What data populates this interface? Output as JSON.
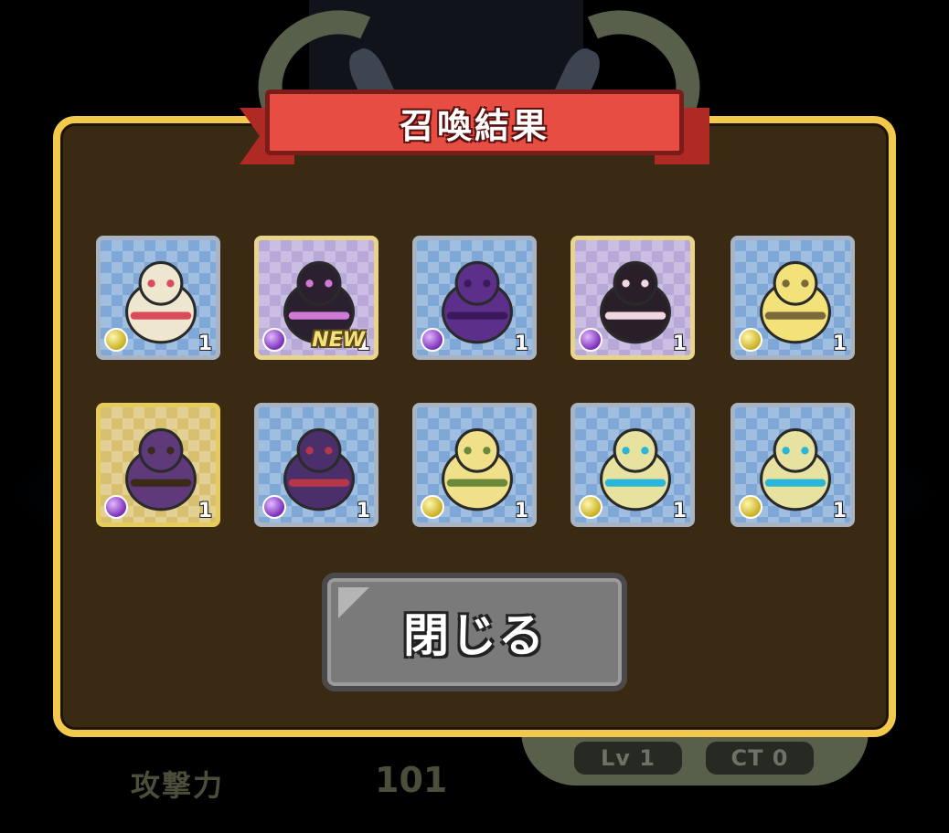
{
  "dialog": {
    "title": "召喚結果",
    "close_label": "閉じる"
  },
  "results": [
    {
      "element": "gold",
      "rarity": "normal",
      "count": "1",
      "new_badge": "",
      "body_color": "#efe6cf",
      "accent_color": "#d94b5a"
    },
    {
      "element": "purple",
      "rarity": "rainbow",
      "count": "1",
      "new_badge": "NEW",
      "body_color": "#2b2030",
      "accent_color": "#d07ad8"
    },
    {
      "element": "purple",
      "rarity": "normal",
      "count": "1",
      "new_badge": "",
      "body_color": "#5c2f8a",
      "accent_color": "#3a1a5a"
    },
    {
      "element": "purple",
      "rarity": "rainbow",
      "count": "1",
      "new_badge": "",
      "body_color": "#2a1e28",
      "accent_color": "#f0d8e0"
    },
    {
      "element": "gold",
      "rarity": "normal",
      "count": "1",
      "new_badge": "",
      "body_color": "#f3e27a",
      "accent_color": "#7a6a3a"
    },
    {
      "element": "purple",
      "rarity": "gold",
      "count": "1",
      "new_badge": "",
      "body_color": "#5e3a7a",
      "accent_color": "#3a2a1a"
    },
    {
      "element": "purple",
      "rarity": "normal",
      "count": "1",
      "new_badge": "",
      "body_color": "#4a2f6a",
      "accent_color": "#b8364a"
    },
    {
      "element": "gold",
      "rarity": "normal",
      "count": "1",
      "new_badge": "",
      "body_color": "#f0e08a",
      "accent_color": "#6a8a3a"
    },
    {
      "element": "gold",
      "rarity": "normal",
      "count": "1",
      "new_badge": "",
      "body_color": "#e8e2a0",
      "accent_color": "#2ab6d8"
    },
    {
      "element": "gold",
      "rarity": "normal",
      "count": "1",
      "new_badge": "",
      "body_color": "#e8e2a0",
      "accent_color": "#2ab6d8"
    }
  ],
  "background": {
    "stat_label": "攻撃力",
    "stat_value": "101",
    "level_label": "Lv 1",
    "ct_label": "CT 0"
  },
  "colors": {
    "panel_bg": "#3a2a14",
    "panel_border": "#f2c94c",
    "banner": "#e84d43",
    "close_button": "#7a7a7a"
  }
}
